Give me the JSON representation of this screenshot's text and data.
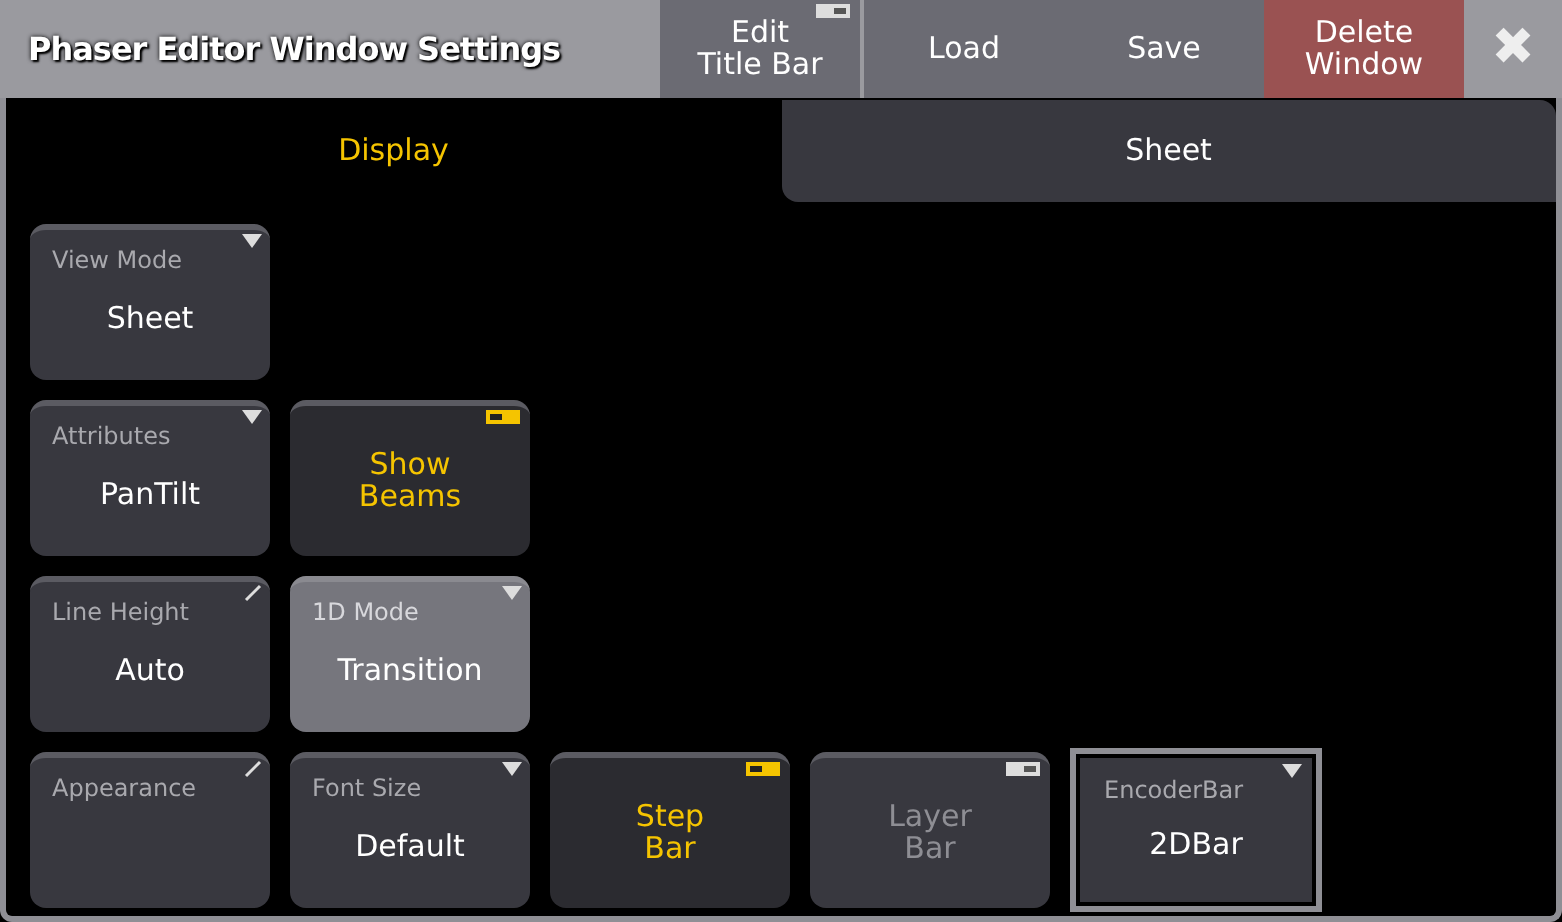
{
  "window": {
    "title": "Phaser Editor Window Settings"
  },
  "title_buttons": [
    {
      "label": "Edit\nTitle Bar",
      "kind": "toggle",
      "on": false
    },
    {
      "label": "Load",
      "kind": "plain"
    },
    {
      "label": "Save",
      "kind": "plain"
    },
    {
      "label": "Delete\nWindow",
      "kind": "danger"
    },
    {
      "label": "✖",
      "kind": "close"
    }
  ],
  "tabs": [
    {
      "label": "Display",
      "selected": true
    },
    {
      "label": "Sheet",
      "selected": false
    }
  ],
  "rows": [
    [
      {
        "kind": "dropdown",
        "label": "View Mode",
        "value": "Sheet",
        "active": false,
        "focused": false
      }
    ],
    [
      {
        "kind": "dropdown",
        "label": "Attributes",
        "value": "PanTilt",
        "active": false,
        "focused": false
      },
      {
        "kind": "toggle",
        "value": "Show\nBeams",
        "on": true
      }
    ],
    [
      {
        "kind": "edit",
        "label": "Line Height",
        "value": "Auto",
        "active": false,
        "focused": false
      },
      {
        "kind": "dropdown",
        "label": "1D Mode",
        "value": "Transition",
        "active": true,
        "focused": false
      }
    ],
    [
      {
        "kind": "edit",
        "label": "Appearance",
        "active": false,
        "focused": false
      },
      {
        "kind": "dropdown",
        "label": "Font Size",
        "value": "Default",
        "active": false,
        "focused": false
      },
      {
        "kind": "toggle",
        "value": "Step\nBar",
        "on": true
      },
      {
        "kind": "toggle",
        "value": "Layer\nBar",
        "on": false
      },
      {
        "kind": "dropdown",
        "label": "EncoderBar",
        "value": "2DBar",
        "active": false,
        "focused": true
      }
    ]
  ]
}
